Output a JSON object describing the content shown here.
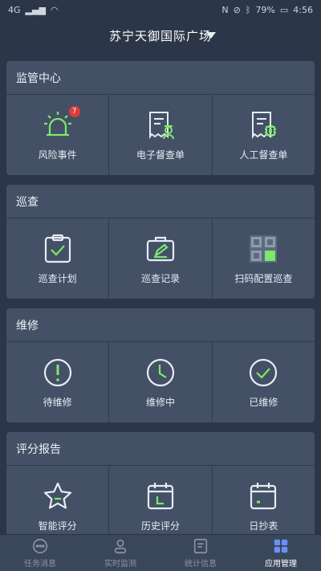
{
  "status_bar": {
    "left": "4G",
    "battery": "79%",
    "time": "4:56"
  },
  "header": {
    "title": "苏宁天御国际广场"
  },
  "sections": [
    {
      "title": "监管中心",
      "items": [
        {
          "label": "风险事件",
          "icon": "alarm-light-icon",
          "badge": "7"
        },
        {
          "label": "电子督查单",
          "icon": "document-officer-icon"
        },
        {
          "label": "人工督查单",
          "icon": "document-chip-icon"
        }
      ]
    },
    {
      "title": "巡查",
      "items": [
        {
          "label": "巡查计划",
          "icon": "clipboard-check-icon"
        },
        {
          "label": "巡查记录",
          "icon": "briefcase-edit-icon"
        },
        {
          "label": "扫码配置巡查",
          "icon": "qr-code-icon"
        }
      ]
    },
    {
      "title": "维修",
      "items": [
        {
          "label": "待维修",
          "icon": "exclamation-circle-icon"
        },
        {
          "label": "维修中",
          "icon": "clock-icon"
        },
        {
          "label": "已维修",
          "icon": "check-circle-icon"
        }
      ]
    },
    {
      "title": "评分报告",
      "items": [
        {
          "label": "智能评分",
          "icon": "star-icon"
        },
        {
          "label": "历史评分",
          "icon": "calendar-l-icon"
        },
        {
          "label": "日抄表",
          "icon": "calendar-icon"
        }
      ]
    }
  ],
  "tabbar": {
    "tabs": [
      {
        "label": "任务消息",
        "icon": "chat-icon"
      },
      {
        "label": "实时监测",
        "icon": "user-icon"
      },
      {
        "label": "统计信息",
        "icon": "list-doc-icon"
      },
      {
        "label": "应用管理",
        "icon": "apps-grid-icon",
        "active": true
      }
    ]
  },
  "colors": {
    "accent": "#7de86b",
    "background": "#2b3648",
    "card": "#435066",
    "badge": "#e03b3b",
    "tab_active": "#6a8ff5"
  }
}
